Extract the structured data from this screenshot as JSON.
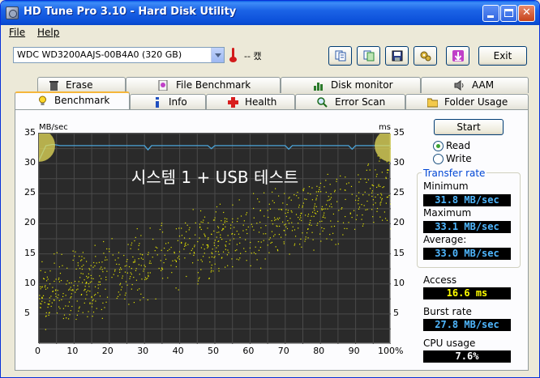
{
  "window": {
    "title": "HD Tune Pro 3.10 - Hard Disk Utility"
  },
  "menu": {
    "file": "File",
    "help": "Help"
  },
  "toolbar": {
    "drive": "WDC WD3200AAJS-00B4A0 (320 GB)",
    "temperature": "-- 캤",
    "exit_label": "Exit",
    "icons": [
      "copy-text-icon",
      "copy-screenshot-icon",
      "save-icon",
      "options-icon",
      "download-icon"
    ]
  },
  "tabs": {
    "row_back": [
      {
        "label": "Erase",
        "icon": "trash-icon"
      },
      {
        "label": "File Benchmark",
        "icon": "file-benchmark-icon"
      },
      {
        "label": "Disk monitor",
        "icon": "disk-monitor-icon"
      },
      {
        "label": "AAM",
        "icon": "speaker-icon"
      }
    ],
    "row_front": [
      {
        "label": "Benchmark",
        "icon": "lightbulb-icon",
        "active": true
      },
      {
        "label": "Info",
        "icon": "info-icon"
      },
      {
        "label": "Health",
        "icon": "health-cross-icon"
      },
      {
        "label": "Error Scan",
        "icon": "magnifier-icon"
      },
      {
        "label": "Folder Usage",
        "icon": "folder-icon"
      }
    ]
  },
  "graph": {
    "left_unit": "MB/sec",
    "right_unit": "ms",
    "overlay_text": "시스템 1 + USB 테스트",
    "y_ticks": [
      "35",
      "30",
      "25",
      "20",
      "15",
      "10",
      "5"
    ],
    "x_ticks": [
      "0",
      "10",
      "20",
      "30",
      "40",
      "50",
      "60",
      "70",
      "80",
      "90",
      "100%"
    ]
  },
  "chart_data": {
    "type": "line",
    "xlim": [
      0,
      100
    ],
    "ylim": [
      0,
      35
    ],
    "y2lim": [
      0,
      35
    ],
    "xlabel": "",
    "ylabel": "MB/sec",
    "y2label": "ms",
    "grid": true,
    "series": [
      {
        "name": "Read",
        "color": "#4aa3d8",
        "x": [
          0,
          2,
          4,
          6,
          10,
          20,
          30,
          31,
          32,
          40,
          48,
          49,
          50,
          60,
          70,
          71,
          72,
          80,
          88,
          89,
          90,
          95,
          100
        ],
        "values": [
          30.5,
          33.0,
          33.2,
          33.0,
          33.0,
          33.0,
          33.0,
          32.3,
          33.0,
          33.0,
          33.0,
          32.5,
          33.0,
          33.0,
          33.0,
          32.4,
          33.0,
          33.0,
          33.0,
          32.4,
          33.0,
          33.0,
          33.0
        ]
      },
      {
        "type": "scatter",
        "color": "#e6e600",
        "trend_x": [
          0,
          100
        ],
        "trend_access_ms": [
          8,
          26
        ],
        "spread_ms": 7
      }
    ]
  },
  "controls": {
    "start": "Start",
    "read": "Read",
    "write": "Write"
  },
  "results": {
    "transfer_rate_title": "Transfer rate",
    "minimum_label": "Minimum",
    "minimum_value": "31.8 MB/sec",
    "maximum_label": "Maximum",
    "maximum_value": "33.1 MB/sec",
    "average_label": "Average:",
    "average_value": "33.0 MB/sec",
    "access_label": "Access",
    "access_value": "16.6 ms",
    "burst_label": "Burst rate",
    "burst_value": "27.8 MB/sec",
    "cpu_label": "CPU usage",
    "cpu_value": "7.6%"
  },
  "colors": {
    "transfer_values": "#4fb7ff",
    "access_values": "#ffff00",
    "read_line": "#4aa3d8",
    "access_points": "#e6e600"
  }
}
